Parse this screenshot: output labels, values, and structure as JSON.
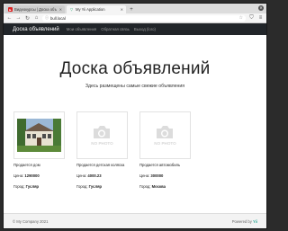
{
  "browser": {
    "tabs": [
      {
        "title": "Видеокурсы | Доска объ",
        "active": false,
        "favicon": "youtube-icon"
      },
      {
        "title": "My Yii Application",
        "active": true,
        "favicon": "yii-icon"
      }
    ],
    "url": "bull.local"
  },
  "site": {
    "brand": "Доска объявлений",
    "nav": [
      "Мои объявления",
      "Обратная связь",
      "Выход (loro)"
    ]
  },
  "hero": {
    "title": "Доска объявлений",
    "subtitle": "Здесь размещены самые свежие объявления"
  },
  "listings": [
    {
      "title": "Продается дом",
      "price_label": "Цена:",
      "price": "1290000",
      "city_label": "Город:",
      "city": "Гусляр",
      "has_photo": true
    },
    {
      "title": "Продается детская коляска",
      "price_label": "Цена:",
      "price": "4000.23",
      "city_label": "Город:",
      "city": "Гусляр",
      "has_photo": false
    },
    {
      "title": "Продается автомобиль",
      "price_label": "Цена:",
      "price": "300000",
      "city_label": "Город:",
      "city": "Москва",
      "has_photo": false
    }
  ],
  "placeholder_text": "NO PHOTO",
  "footer": {
    "left": "© My Company 2021",
    "right_prefix": "Powered by",
    "right_brand": "Yii"
  },
  "colors": {
    "header_bg": "#212529",
    "footer_bg": "#f3f3f3"
  }
}
